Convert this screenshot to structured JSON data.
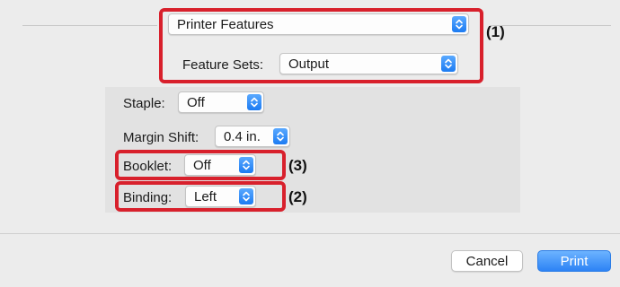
{
  "panel_selector": {
    "value": "Printer Features"
  },
  "feature_sets": {
    "label": "Feature Sets:",
    "value": "Output"
  },
  "options": {
    "staple": {
      "label": "Staple:",
      "value": "Off"
    },
    "margin_shift": {
      "label": "Margin Shift:",
      "value": "0.4 in."
    },
    "booklet": {
      "label": "Booklet:",
      "value": "Off"
    },
    "binding": {
      "label": "Binding:",
      "value": "Left"
    }
  },
  "callouts": {
    "one": "(1)",
    "two": "(2)",
    "three": "(3)"
  },
  "buttons": {
    "cancel": "Cancel",
    "print": "Print"
  },
  "colors": {
    "accent": "#1c7bf2",
    "highlight": "#d8202c"
  },
  "icons": {
    "stepper": "up-down-chevron-icon"
  }
}
